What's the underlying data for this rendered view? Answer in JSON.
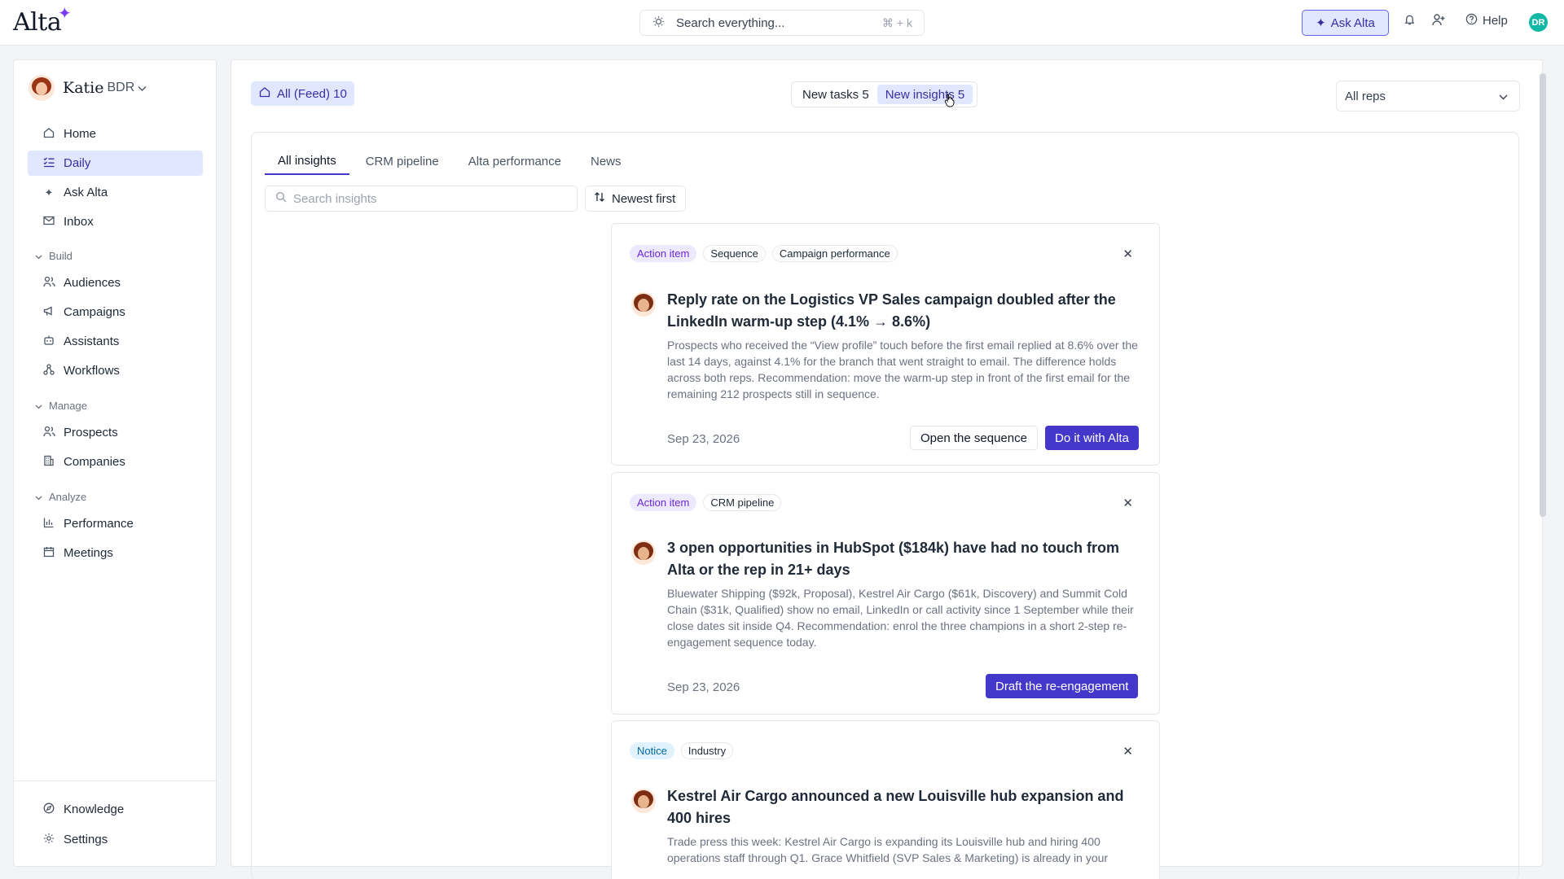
{
  "header": {
    "logo": "Alta",
    "search_placeholder": "Search everything...",
    "search_shortcut": "⌘ + k",
    "ask_label": "Ask Alta",
    "help_label": "Help",
    "avatar_initials": "DR"
  },
  "sidebar": {
    "user_name": "Katie",
    "user_role": "BDR",
    "items_top": [
      {
        "label": "Home",
        "icon": "home-icon"
      },
      {
        "label": "Daily",
        "icon": "checklist-icon",
        "active": true
      },
      {
        "label": "Ask Alta",
        "icon": "sparkle-icon"
      },
      {
        "label": "Inbox",
        "icon": "mail-icon"
      }
    ],
    "sections": [
      {
        "label": "Build",
        "items": [
          "Audiences",
          "Campaigns",
          "Assistants",
          "Workflows"
        ]
      },
      {
        "label": "Manage",
        "items": [
          "Prospects",
          "Companies"
        ]
      },
      {
        "label": "Analyze",
        "items": [
          "Performance",
          "Meetings"
        ]
      }
    ],
    "items_bottom": [
      "Knowledge",
      "Settings"
    ]
  },
  "main": {
    "feed_chip": "All (Feed) 10",
    "segments": [
      "New tasks 5",
      "New insights 5"
    ],
    "reps_select": "All reps",
    "tabs": [
      "All insights",
      "CRM pipeline",
      "Alta performance",
      "News"
    ],
    "insight_search_placeholder": "Search insights",
    "sort_label": "Newest first"
  },
  "cards": [
    {
      "tags": [
        "Action item",
        "Sequence",
        "Campaign performance"
      ],
      "title": "Reply rate on the Logistics VP Sales campaign doubled after the LinkedIn warm-up step (4.1% → 8.6%)",
      "body": "Prospects who received the “View profile” touch before the first email replied at 8.6% over the last 14 days, against 4.1% for the branch that went straight to email. The difference holds across both reps. Recommendation: move the warm-up step in front of the first email for the remaining 212 prospects still in sequence.",
      "date": "Sep 23, 2026",
      "secondary": "Open the sequence",
      "primary": "Do it with Alta"
    },
    {
      "tags": [
        "Action item",
        "CRM pipeline"
      ],
      "title": "3 open opportunities in HubSpot ($184k) have had no touch from Alta or the rep in 21+ days",
      "body": "Bluewater Shipping ($92k, Proposal), Kestrel Air Cargo ($61k, Discovery) and Summit Cold Chain ($31k, Qualified) show no email, LinkedIn or call activity since 1 September while their close dates sit inside Q4. Recommendation: enrol the three champions in a short 2-step re-engagement sequence today.",
      "date": "Sep 23, 2026",
      "primary": "Draft the re-engagement"
    },
    {
      "tags": [
        "Notice",
        "Industry"
      ],
      "title": "Kestrel Air Cargo announced a new Louisville hub expansion and 400 hires",
      "body": "Trade press this week: Kestrel Air Cargo is expanding its Louisville hub and hiring 400 operations staff through Q1. Grace Whitfield (SVP Sales & Marketing) is already in your"
    }
  ],
  "colors": {
    "accent": "#4338ca",
    "accent_soft": "#e0e7ff",
    "action_tag": "#ede9fe",
    "notice_tag": "#e0f2fe"
  }
}
